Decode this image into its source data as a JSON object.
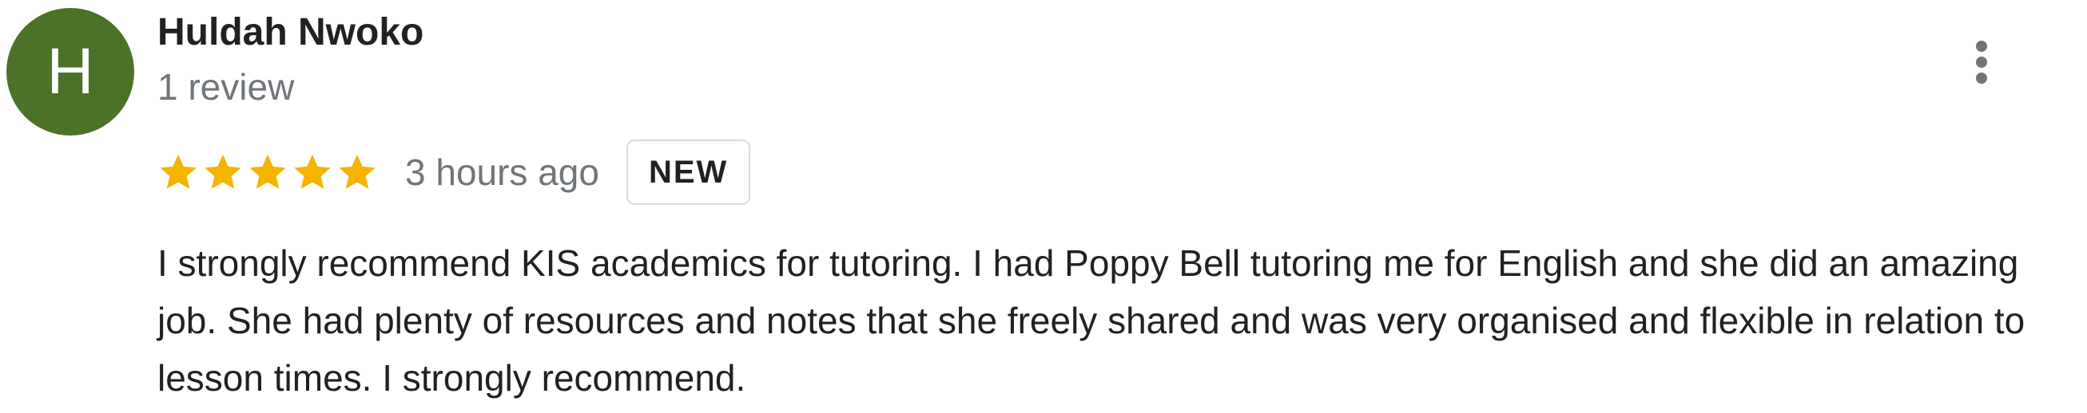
{
  "review": {
    "avatar_letter": "H",
    "avatar_color": "#4b7328",
    "author_name": "Huldah Nwoko",
    "review_count": "1 review",
    "rating": 5,
    "rating_max": 5,
    "star_color": "#f4b400",
    "timestamp": "3 hours ago",
    "badge": "NEW",
    "text": "I strongly recommend KIS academics for tutoring. I had Poppy Bell tutoring me for English and she did an amazing job. She had plenty of resources and notes that she freely shared and was very organised and flexible in relation to lesson times. I strongly recommend.",
    "more_options_icon": "more-vert-icon"
  }
}
